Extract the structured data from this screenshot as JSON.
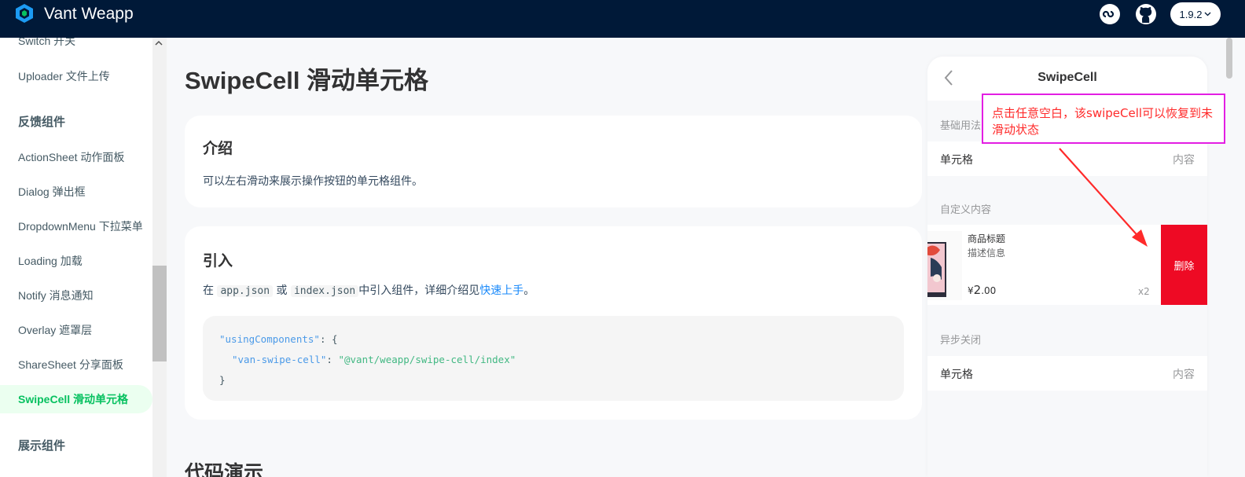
{
  "header": {
    "brand": "Vant Weapp",
    "version": "1.9.2",
    "icons": [
      "mini-program-icon",
      "github-icon",
      "chevron-down-icon"
    ]
  },
  "sidebar": {
    "items": [
      {
        "label": "Switch 开关"
      },
      {
        "label": "Uploader 文件上传"
      },
      {
        "label": "ActionSheet 动作面板"
      },
      {
        "label": "Dialog 弹出框"
      },
      {
        "label": "DropdownMenu 下拉菜单"
      },
      {
        "label": "Loading 加载"
      },
      {
        "label": "Notify 消息通知"
      },
      {
        "label": "Overlay 遮罩层"
      },
      {
        "label": "ShareSheet 分享面板"
      },
      {
        "label": "SwipeCell 滑动单元格"
      }
    ],
    "groups": {
      "feedback": "反馈组件",
      "display": "展示组件"
    }
  },
  "main": {
    "title": "SwipeCell 滑动单元格",
    "intro": {
      "heading": "介绍",
      "text": "可以左右滑动来展示操作按钮的单元格组件。"
    },
    "import": {
      "heading": "引入",
      "text_before": "在",
      "tag1": "app.json",
      "text_or": "或",
      "tag2": "index.json",
      "text_mid": "中引入组件，详细介绍见",
      "link": "快速上手",
      "text_end": "。",
      "code": {
        "key1": "\"usingComponents\"",
        "open": ": {",
        "key2": "\"van-swipe-cell\"",
        "colon": ": ",
        "value2": "\"@vant/weapp/swipe-cell/index\"",
        "close": "}"
      }
    },
    "demo_heading": "代码演示"
  },
  "simulator": {
    "title": "SwipeCell",
    "sections": {
      "basic": "基础用法",
      "custom": "自定义内容",
      "async": "异步关闭"
    },
    "cell_title": "单元格",
    "cell_value": "内容",
    "cell_title_2": "单元格",
    "cell_value_2": "内容",
    "goods": {
      "title": "商品标题",
      "desc": "描述信息",
      "currency": "¥",
      "price_int": "2",
      "price_dec": ".00",
      "num": "x2"
    },
    "delete_label": "删除"
  },
  "annotation": {
    "text": "点击任意空白，该swipeCell可以恢复到未滑动状态",
    "color": "#ff2a2a",
    "border_color": "#e31ee3"
  },
  "colors": {
    "header_bg": "#001938",
    "active_green": "#07c160",
    "delete_red": "#ee0a24",
    "link_blue": "#1989fa"
  }
}
